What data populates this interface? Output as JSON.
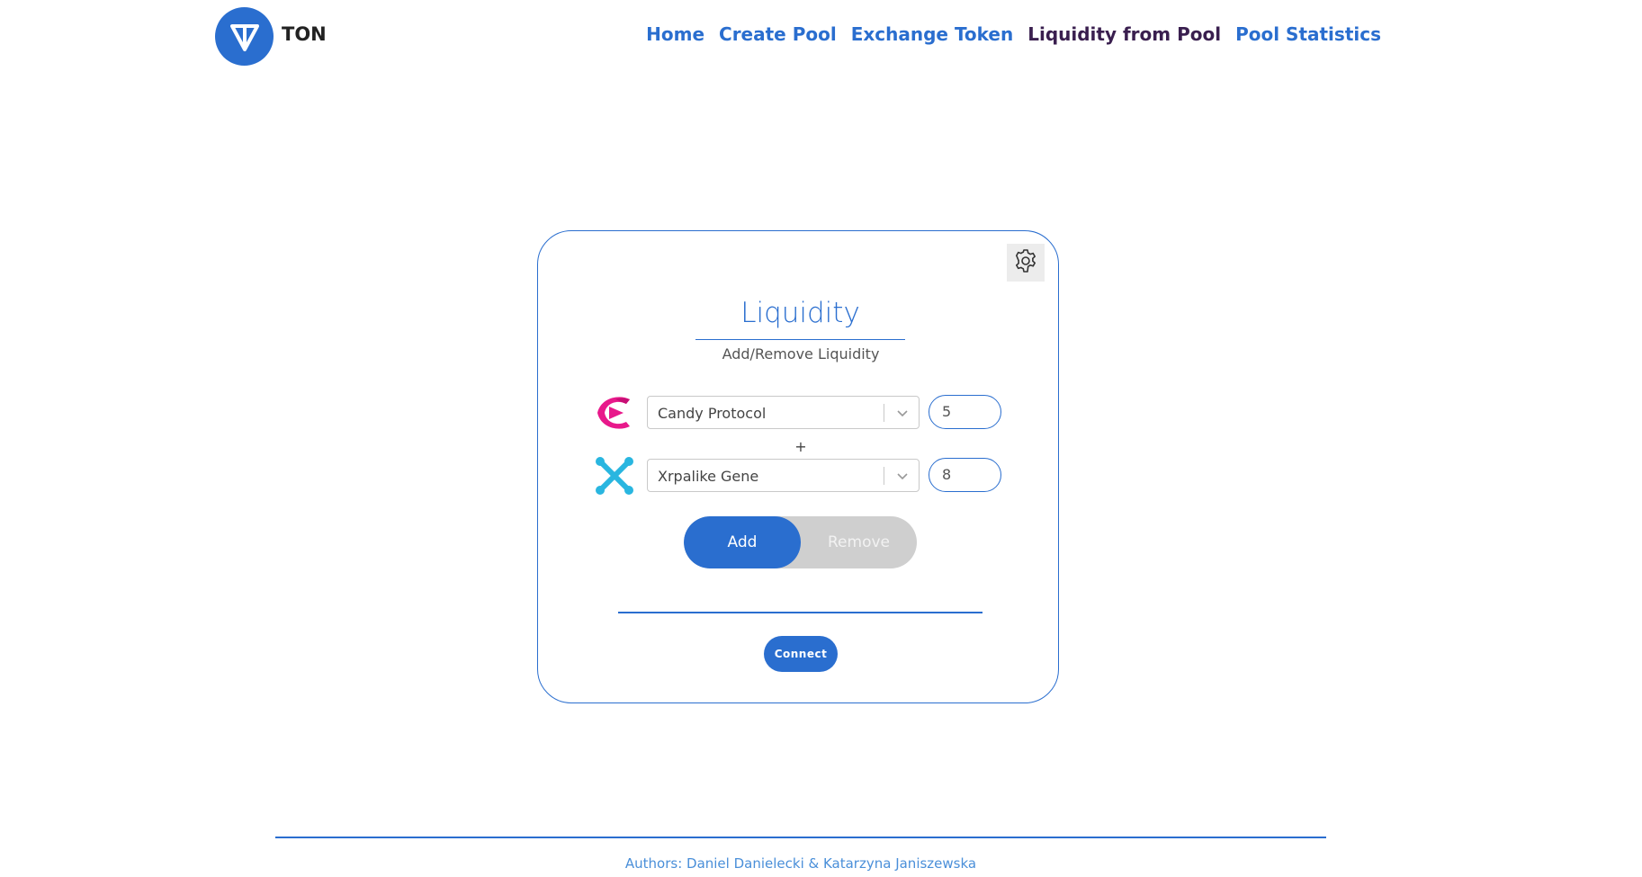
{
  "header": {
    "brand": "TON",
    "nav": [
      {
        "label": "Home",
        "active": false
      },
      {
        "label": "Create Pool",
        "active": false
      },
      {
        "label": "Exchange Token",
        "active": false
      },
      {
        "label": "Liquidity from Pool",
        "active": true
      },
      {
        "label": "Pool Statistics",
        "active": false
      }
    ]
  },
  "card": {
    "title": "Liquidity",
    "subtitle": "Add/Remove Liquidity",
    "settings_icon": "gear-icon",
    "token_a": {
      "name": "Candy Protocol",
      "amount": "5",
      "icon": "candy-protocol-logo"
    },
    "separator": "+",
    "token_b": {
      "name": "Xrpalike Gene",
      "amount": "8",
      "icon": "xrpalike-gene-logo"
    },
    "toggle": {
      "add": "Add",
      "remove": "Remove",
      "selected": "Add"
    },
    "connect_label": "Connect"
  },
  "footer": {
    "authors": "Authors: Daniel Danielecki & Katarzyna Janiszewska"
  },
  "colors": {
    "accent": "#2a6ecf",
    "active_nav": "#3a1f4f",
    "toggle_off": "#cfcfcf"
  }
}
